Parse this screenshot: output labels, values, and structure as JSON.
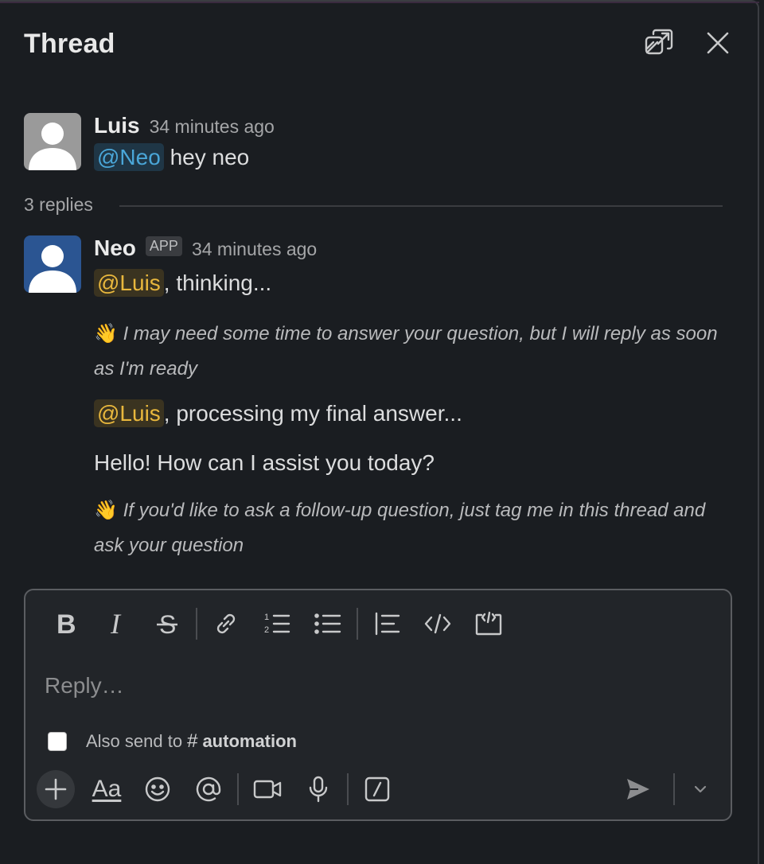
{
  "header": {
    "title": "Thread",
    "popout_icon": "popout-icon",
    "close_icon": "close-icon"
  },
  "root_message": {
    "author": "Luis",
    "timestamp": "34 minutes ago",
    "mention": "@Neo",
    "text": " hey neo"
  },
  "replies": {
    "count_label": "3 replies"
  },
  "reply_message": {
    "author": "Neo",
    "badge": "APP",
    "timestamp": "34 minutes ago",
    "lines": {
      "l1_mention": "@Luis",
      "l1_text": ", thinking...",
      "l2_emoji": "👋",
      "l2_text": "I may need some time to answer your question, but I will reply as soon as I'm ready",
      "l3_mention": "@Luis",
      "l3_text": ", processing my final answer...",
      "l4_text": "Hello! How can I assist you today?",
      "l5_emoji": "👋",
      "l5_text": "If you'd like to ask a follow-up question, just tag me in this thread and ask your question"
    }
  },
  "composer": {
    "placeholder": "Reply…",
    "also_send_label": "Also send to",
    "hash": "#",
    "channel": "automation",
    "format_label": "Aa",
    "toolbar_icons": [
      "bold-icon",
      "italic-icon",
      "strikethrough-icon",
      "link-icon",
      "ordered-list-icon",
      "bullet-list-icon",
      "blockquote-icon",
      "code-icon",
      "code-block-icon"
    ],
    "bottom_icons": [
      "plus-icon",
      "format-icon",
      "emoji-icon",
      "mention-icon",
      "video-icon",
      "microphone-icon",
      "shortcut-icon",
      "send-icon",
      "chevron-down-icon"
    ]
  },
  "colors": {
    "background": "#1a1d21",
    "mention_blue": "#4aa6d8",
    "mention_yellow": "#e8b73d"
  }
}
